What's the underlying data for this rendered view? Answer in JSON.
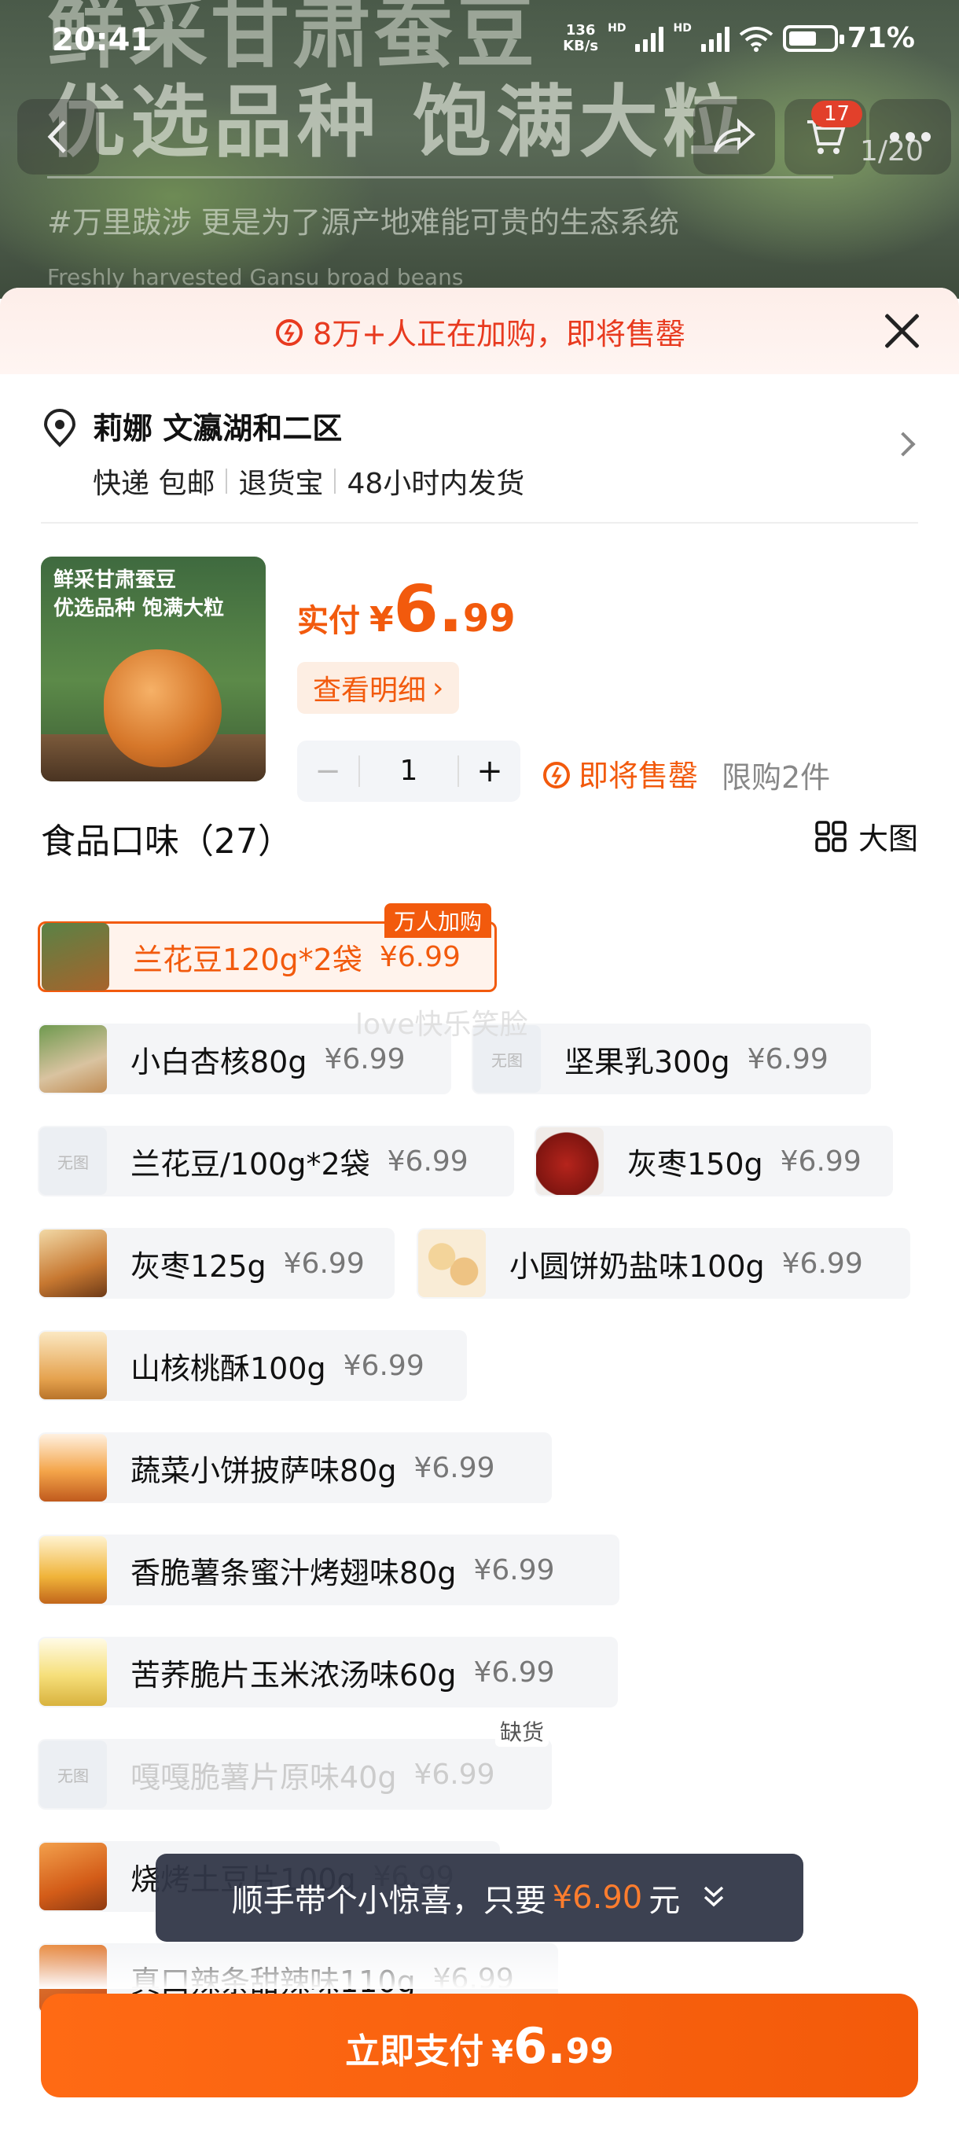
{
  "status_bar": {
    "time": "20:41",
    "net_speed_top": "136",
    "net_speed_bottom": "KB/s",
    "hd1": "HD",
    "hd2": "HD",
    "battery": "71%"
  },
  "background": {
    "headline_line1": "鲜采甘肃蚕豆",
    "headline_line2": "优选品种 饱满大粒",
    "subline": "#万里跋涉 更是为了源产地难能可贵的生态系统",
    "english": "Freshly harvested Gansu broad beans"
  },
  "top_nav": {
    "cart_count": "17",
    "image_index": "1/20"
  },
  "banner": {
    "text": "8万+人正在加购，即将售罄"
  },
  "address": {
    "name": "莉娜 文瀛湖和二区",
    "shipping": [
      "快递 包邮",
      "退货宝",
      "48小时内发货"
    ]
  },
  "product": {
    "thumb_line1": "鲜采甘肃蚕豆",
    "thumb_line2": "优选品种 饱满大粒",
    "paid_label": "实付",
    "currency": "¥",
    "price_int": "6.",
    "price_dec": "99",
    "detail_button": "查看明细",
    "quantity": "1",
    "minus": "−",
    "plus": "+",
    "soldout_text": "即将售罄",
    "limit_text": "限购2件"
  },
  "flavors": {
    "title": "食品口味（27）",
    "big_image_label": "大图",
    "no_image_text": "无图",
    "badge_popular": "万人加购",
    "badge_oos": "缺货",
    "items": [
      {
        "name": "兰花豆120g*2袋",
        "price": "¥6.99",
        "state": "selected",
        "image": "beanpack"
      },
      {
        "name": "小白杏核80g",
        "price": "¥6.99",
        "state": "normal",
        "image": "almond"
      },
      {
        "name": "坚果乳300g",
        "price": "¥6.99",
        "state": "normal",
        "image": "none"
      },
      {
        "name": "兰花豆/100g*2袋",
        "price": "¥6.99",
        "state": "normal",
        "image": "none"
      },
      {
        "name": "灰枣150g",
        "price": "¥6.99",
        "state": "normal",
        "image": "jujube"
      },
      {
        "name": "灰枣125g",
        "price": "¥6.99",
        "state": "normal",
        "image": "jujube2"
      },
      {
        "name": "小圆饼奶盐味100g",
        "price": "¥6.99",
        "state": "normal",
        "image": "biscuit"
      },
      {
        "name": "山核桃酥100g",
        "price": "¥6.99",
        "state": "normal",
        "image": "walnut"
      },
      {
        "name": "蔬菜小饼披萨味80g",
        "price": "¥6.99",
        "state": "normal",
        "image": "pizza"
      },
      {
        "name": "香脆薯条蜜汁烤翅味80g",
        "price": "¥6.99",
        "state": "normal",
        "image": "fries"
      },
      {
        "name": "苦荞脆片玉米浓汤味60g",
        "price": "¥6.99",
        "state": "normal",
        "image": "buckwheat"
      },
      {
        "name": "嘎嘎脆薯片原味40g",
        "price": "¥6.99",
        "state": "out_of_stock",
        "image": "none"
      },
      {
        "name": "烧烤土豆片100g",
        "price": "¥6.99",
        "state": "normal",
        "image": "potato"
      },
      {
        "name": "真口辣条甜辣味110g",
        "price": "¥6.99",
        "state": "normal",
        "image": "strips"
      }
    ]
  },
  "watermark": "love快乐笑脸",
  "toast": {
    "text": "顺手带个小惊喜，只要",
    "amount": "¥6.90",
    "unit": "元"
  },
  "pay_button": {
    "label": "立即支付",
    "currency": "¥",
    "price_int": "6.",
    "price_dec": "99"
  },
  "colors": {
    "accent": "#f25a0d",
    "alert_red": "#e83a1f",
    "toast_bg": "#32374a"
  }
}
